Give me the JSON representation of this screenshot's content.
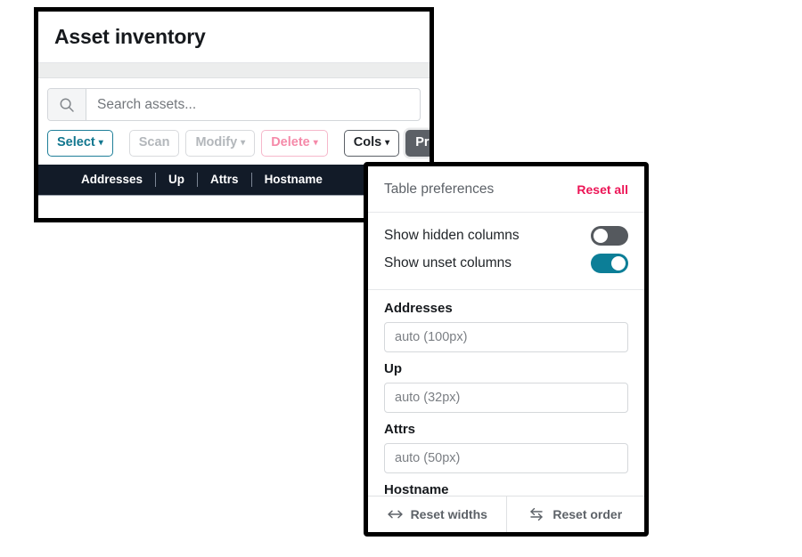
{
  "main_window": {
    "title": "Asset inventory",
    "search": {
      "placeholder": "Search assets...",
      "value": "",
      "icon": "search-icon"
    },
    "toolbar": [
      {
        "label": "Select",
        "caret": "▾",
        "style": "select"
      },
      {
        "label": "Scan",
        "caret": "",
        "style": "disabled"
      },
      {
        "label": "Modify",
        "caret": "▾",
        "style": "disabled"
      },
      {
        "label": "Delete",
        "caret": "▾",
        "style": "danger"
      },
      {
        "label": "Cols",
        "caret": "▾",
        "style": "plain"
      },
      {
        "label": "Prefs",
        "caret": "▾",
        "style": "active"
      }
    ],
    "table_headers": [
      "Addresses",
      "Up",
      "Attrs",
      "Hostname"
    ]
  },
  "prefs_panel": {
    "title": "Table preferences",
    "reset_all_label": "Reset all",
    "toggles": [
      {
        "label": "Show hidden columns",
        "state": "off"
      },
      {
        "label": "Show unset columns",
        "state": "on"
      }
    ],
    "fields": [
      {
        "label": "Addresses",
        "placeholder": "auto (100px)",
        "value": ""
      },
      {
        "label": "Up",
        "placeholder": "auto (32px)",
        "value": ""
      },
      {
        "label": "Attrs",
        "placeholder": "auto (50px)",
        "value": ""
      },
      {
        "label": "Hostname",
        "placeholder": "",
        "value": ""
      }
    ],
    "footer": [
      {
        "label": "Reset widths",
        "icon": "left-right-arrow-icon"
      },
      {
        "label": "Reset order",
        "icon": "swap-arrows-icon"
      }
    ]
  },
  "colors": {
    "accent_teal": "#0c7e97",
    "danger_pink": "#ec1556",
    "table_header_bg": "#121b28",
    "active_button_bg": "#5c6066"
  }
}
